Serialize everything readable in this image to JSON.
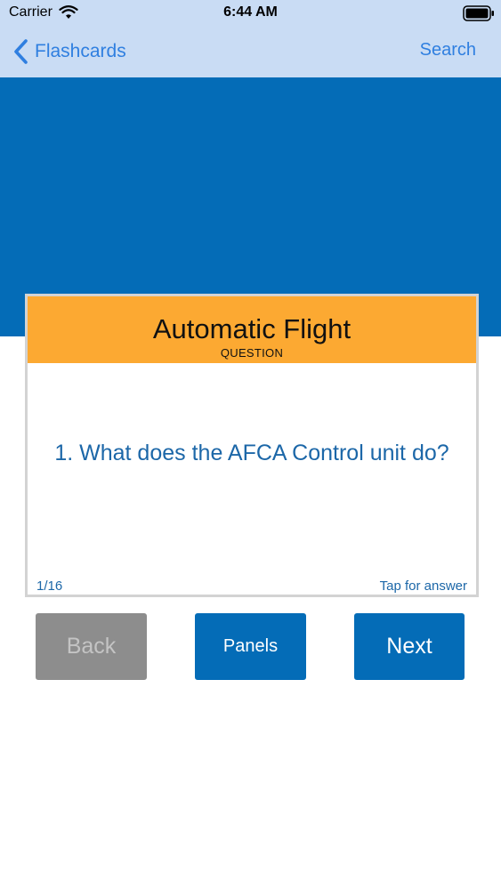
{
  "status_bar": {
    "carrier": "Carrier",
    "time": "6:44 AM",
    "icons": [
      "wifi-icon",
      "battery-icon"
    ]
  },
  "nav": {
    "back_label": "Flashcards",
    "back_icon": "chevron-left-icon",
    "search_label": "Search"
  },
  "card": {
    "title": "Automatic Flight",
    "subtitle": "QUESTION",
    "question": "1. What does the AFCA Control unit do?",
    "counter": "1/16",
    "hint": "Tap for answer"
  },
  "buttons": {
    "back": "Back",
    "panels": "Panels",
    "next": "Next"
  },
  "colors": {
    "nav_background": "#c9dcf4",
    "brand_blue": "#046cb7",
    "card_header": "#fca932",
    "link_blue": "#2f7fe0",
    "question_text": "#1c67a8",
    "disabled_button": "#8d8d8d"
  }
}
